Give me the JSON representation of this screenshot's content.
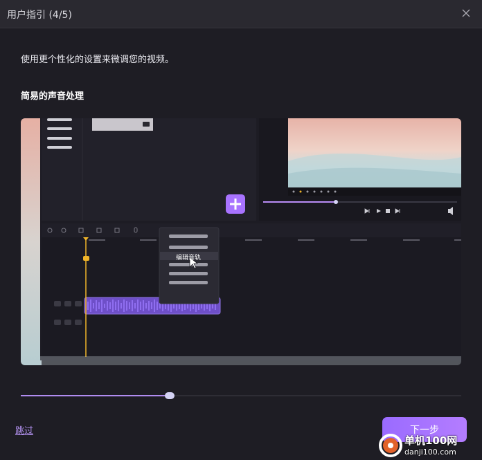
{
  "window": {
    "title": "用户指引 (4/5)",
    "close_icon": "close-icon"
  },
  "content": {
    "subtitle": "使用更个性化的设置来微调您的视频。",
    "section_title": "简易的声音处理"
  },
  "illustration": {
    "context_menu_item": "编辑音轨",
    "add_button_icon": "plus-icon",
    "cursor_icon": "cursor-icon"
  },
  "progress": {
    "fraction": 0.33
  },
  "footer": {
    "skip_label": "跳过",
    "next_label": "下一步"
  },
  "watermark": {
    "title": "单机100网",
    "url": "danji100.com"
  },
  "colors": {
    "accent": "#a873ff",
    "waveform": "#7b57d6",
    "playhead": "#f0b429",
    "background": "#1e1d24"
  }
}
